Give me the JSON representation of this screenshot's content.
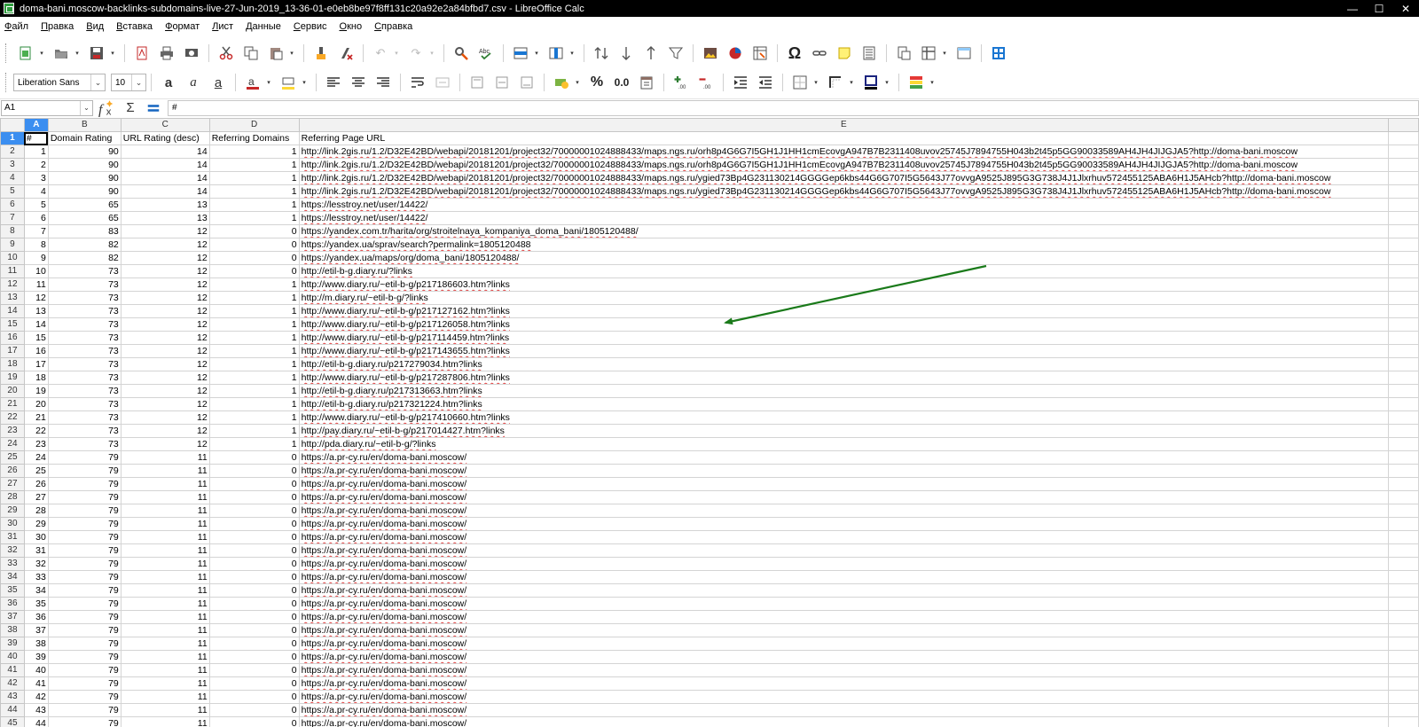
{
  "window": {
    "title": "doma-bani.moscow-backlinks-subdomains-live-27-Jun-2019_13-36-01-e0eb8be97f8ff131c20a92e2a84bfbd7.csv - LibreOffice Calc",
    "minimize": "—",
    "maximize": "☐",
    "close": "✕"
  },
  "menu": [
    "Файл",
    "Правка",
    "Вид",
    "Вставка",
    "Формат",
    "Лист",
    "Данные",
    "Сервис",
    "Окно",
    "Справка"
  ],
  "format_bar": {
    "font_name": "Liberation Sans",
    "font_size": "10"
  },
  "formula_bar": {
    "cell_ref": "A1",
    "content": "#"
  },
  "columns": [
    "A",
    "B",
    "C",
    "D",
    "E"
  ],
  "selected_column": "A",
  "header_row": [
    "#",
    "Domain Rating",
    "URL Rating (desc)",
    "Referring Domains",
    "Referring Page URL"
  ],
  "rows": [
    [
      "1",
      "90",
      "14",
      "1",
      "http://link.2gis.ru/1.2/D32E42BD/webapi/20181201/project32/70000001024888433/maps.ngs.ru/orh8p4G6G7I5GH1J1HH1cmEcovgA947B7B2311408uvov25745J7894755H043b2t45p5GG90033589AH4JH4JIJGJA5?http://doma-bani.moscow"
    ],
    [
      "2",
      "90",
      "14",
      "1",
      "http://link.2gis.ru/1.2/D32E42BD/webapi/20181201/project32/70000001024888433/maps.ngs.ru/orh8p4G6G7I5GH1J1HH1cmEcovgA947B7B2311408uvov25745J7894755H043b2t45p5GG90033589AH4JH4JIJGJA5?http://doma-bani.moscow"
    ],
    [
      "3",
      "90",
      "14",
      "1",
      "http://link.2gis.ru/1.2/D32E42BD/webapi/20181201/project32/70000001024888433/maps.ngs.ru/ygied73Bp4G231130214GGGGep6kbs44G6G707I5G5643J77ovvgA9525J895G3G738J4J1Jlxrhuv572455125ABA6H1J5AHcb?http://doma-bani.moscow"
    ],
    [
      "4",
      "90",
      "14",
      "1",
      "http://link.2gis.ru/1.2/D32E42BD/webapi/20181201/project32/70000001024888433/maps.ngs.ru/ygied73Bp4G231130214GGGGep6kbs44G6G707I5G5643J77ovvgA9525J895G3G738J4J1Jlxrhuv572455125ABA6H1J5AHcb?http://doma-bani.moscow"
    ],
    [
      "5",
      "65",
      "13",
      "1",
      "https://lesstroy.net/user/14422/"
    ],
    [
      "6",
      "65",
      "13",
      "1",
      "https://lesstroy.net/user/14422/"
    ],
    [
      "7",
      "83",
      "12",
      "0",
      "https://yandex.com.tr/harita/org/stroitelnaya_kompaniya_doma_bani/1805120488/"
    ],
    [
      "8",
      "82",
      "12",
      "0",
      "https://yandex.ua/sprav/search?permalink=1805120488"
    ],
    [
      "9",
      "82",
      "12",
      "0",
      "https://yandex.ua/maps/org/doma_bani/1805120488/"
    ],
    [
      "10",
      "73",
      "12",
      "0",
      "http://etil-b-g.diary.ru/?links"
    ],
    [
      "11",
      "73",
      "12",
      "1",
      "http://www.diary.ru/~etil-b-g/p217186603.htm?links"
    ],
    [
      "12",
      "73",
      "12",
      "1",
      "http://m.diary.ru/~etil-b-g/?links"
    ],
    [
      "13",
      "73",
      "12",
      "1",
      "http://www.diary.ru/~etil-b-g/p217127162.htm?links"
    ],
    [
      "14",
      "73",
      "12",
      "1",
      "http://www.diary.ru/~etil-b-g/p217126058.htm?links"
    ],
    [
      "15",
      "73",
      "12",
      "1",
      "http://www.diary.ru/~etil-b-g/p217114459.htm?links"
    ],
    [
      "16",
      "73",
      "12",
      "1",
      "http://www.diary.ru/~etil-b-g/p217143655.htm?links"
    ],
    [
      "17",
      "73",
      "12",
      "1",
      "http://etil-b-g.diary.ru/p217279034.htm?links"
    ],
    [
      "18",
      "73",
      "12",
      "1",
      "http://www.diary.ru/~etil-b-g/p217287806.htm?links"
    ],
    [
      "19",
      "73",
      "12",
      "1",
      "http://etil-b-g.diary.ru/p217313663.htm?links"
    ],
    [
      "20",
      "73",
      "12",
      "1",
      "http://etil-b-g.diary.ru/p217321224.htm?links"
    ],
    [
      "21",
      "73",
      "12",
      "1",
      "http://www.diary.ru/~etil-b-g/p217410660.htm?links"
    ],
    [
      "22",
      "73",
      "12",
      "1",
      "http://pay.diary.ru/~etil-b-g/p217014427.htm?links"
    ],
    [
      "23",
      "73",
      "12",
      "1",
      "http://pda.diary.ru/~etil-b-g/?links"
    ],
    [
      "24",
      "79",
      "11",
      "0",
      "https://a.pr-cy.ru/en/doma-bani.moscow/"
    ],
    [
      "25",
      "79",
      "11",
      "0",
      "https://a.pr-cy.ru/en/doma-bani.moscow/"
    ],
    [
      "26",
      "79",
      "11",
      "0",
      "https://a.pr-cy.ru/en/doma-bani.moscow/"
    ],
    [
      "27",
      "79",
      "11",
      "0",
      "https://a.pr-cy.ru/en/doma-bani.moscow/"
    ],
    [
      "28",
      "79",
      "11",
      "0",
      "https://a.pr-cy.ru/en/doma-bani.moscow/"
    ],
    [
      "29",
      "79",
      "11",
      "0",
      "https://a.pr-cy.ru/en/doma-bani.moscow/"
    ],
    [
      "30",
      "79",
      "11",
      "0",
      "https://a.pr-cy.ru/en/doma-bani.moscow/"
    ],
    [
      "31",
      "79",
      "11",
      "0",
      "https://a.pr-cy.ru/en/doma-bani.moscow/"
    ],
    [
      "32",
      "79",
      "11",
      "0",
      "https://a.pr-cy.ru/en/doma-bani.moscow/"
    ],
    [
      "33",
      "79",
      "11",
      "0",
      "https://a.pr-cy.ru/en/doma-bani.moscow/"
    ],
    [
      "34",
      "79",
      "11",
      "0",
      "https://a.pr-cy.ru/en/doma-bani.moscow/"
    ],
    [
      "35",
      "79",
      "11",
      "0",
      "https://a.pr-cy.ru/en/doma-bani.moscow/"
    ],
    [
      "36",
      "79",
      "11",
      "0",
      "https://a.pr-cy.ru/en/doma-bani.moscow/"
    ],
    [
      "37",
      "79",
      "11",
      "0",
      "https://a.pr-cy.ru/en/doma-bani.moscow/"
    ],
    [
      "38",
      "79",
      "11",
      "0",
      "https://a.pr-cy.ru/en/doma-bani.moscow/"
    ],
    [
      "39",
      "79",
      "11",
      "0",
      "https://a.pr-cy.ru/en/doma-bani.moscow/"
    ],
    [
      "40",
      "79",
      "11",
      "0",
      "https://a.pr-cy.ru/en/doma-bani.moscow/"
    ],
    [
      "41",
      "79",
      "11",
      "0",
      "https://a.pr-cy.ru/en/doma-bani.moscow/"
    ],
    [
      "42",
      "79",
      "11",
      "0",
      "https://a.pr-cy.ru/en/doma-bani.moscow/"
    ],
    [
      "43",
      "79",
      "11",
      "0",
      "https://a.pr-cy.ru/en/doma-bani.moscow/"
    ],
    [
      "44",
      "79",
      "11",
      "0",
      "https://a.pr-cy.ru/en/doma-bani.moscow/"
    ]
  ],
  "annotation": {
    "color": "#1a7a1a"
  },
  "colors": {
    "selection": "#3b8ef0",
    "spellcheck": "#e04040"
  }
}
